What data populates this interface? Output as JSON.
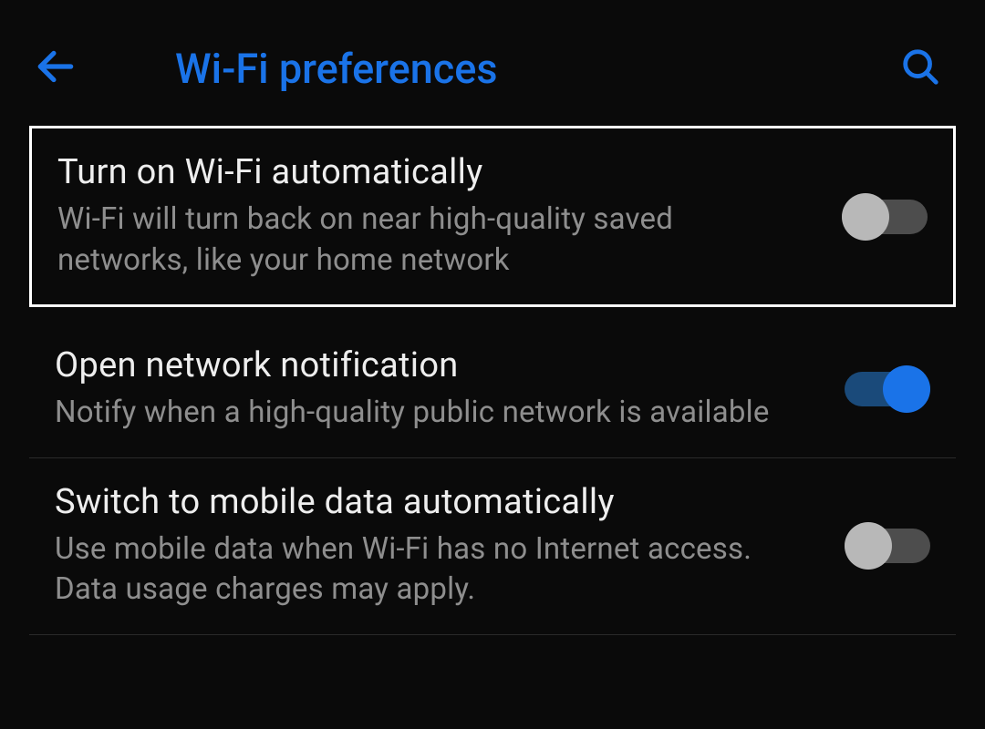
{
  "header": {
    "title": "Wi-Fi preferences"
  },
  "settings": [
    {
      "title": "Turn on Wi-Fi automatically",
      "description": "Wi-Fi will turn back on near high-quality saved networks, like your home network",
      "enabled": false,
      "highlighted": true
    },
    {
      "title": "Open network notification",
      "description": "Notify when a high-quality public network is available",
      "enabled": true,
      "highlighted": false
    },
    {
      "title": "Switch to mobile data automatically",
      "description": "Use mobile data when Wi-Fi has no Internet access. Data usage charges may apply.",
      "enabled": false,
      "highlighted": false
    }
  ]
}
